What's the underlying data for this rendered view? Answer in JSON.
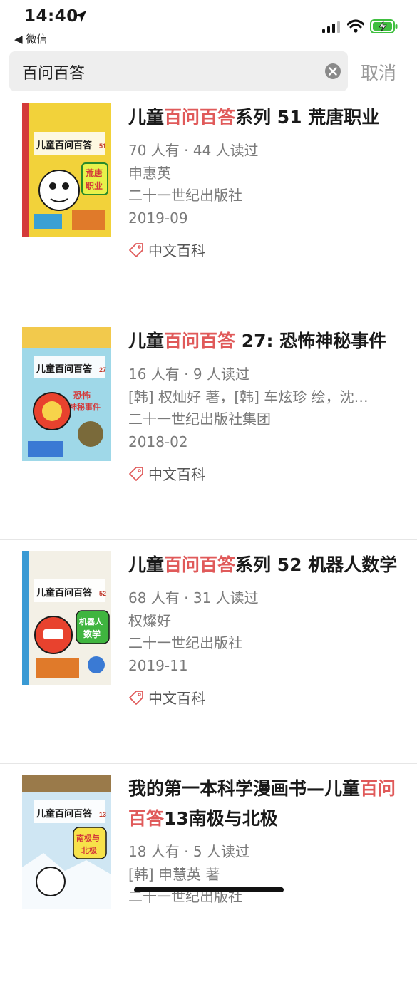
{
  "status_bar": {
    "time": "14:40",
    "back_label": "◀ 微信"
  },
  "search": {
    "query": "百问百答",
    "cancel_label": "取消"
  },
  "results": [
    {
      "title_parts": [
        "儿童",
        "百问百答",
        "系列 51 荒唐职业"
      ],
      "stats": "70 人有 · 44 人读过",
      "author": "申惠英",
      "publisher": "二十一世纪出版社",
      "date": "2019-09",
      "tag": "中文百科",
      "cover": {
        "series": "儿童百问百答",
        "number": "51",
        "topic_lines": [
          "荒唐",
          "职业"
        ],
        "bg": "#f2d23a"
      }
    },
    {
      "title_parts": [
        "儿童",
        "百问百答",
        " 27: 恐怖神秘事件"
      ],
      "stats": "16 人有 · 9 人读过",
      "author": "[韩] 权灿好 著，[韩] 车炫珍 绘，沈…",
      "publisher": "二十一世纪出版社集团",
      "date": "2018-02",
      "tag": "中文百科",
      "cover": {
        "series": "儿童百问百答",
        "number": "27",
        "topic_lines": [
          "恐怖",
          "神秘事件"
        ],
        "bg": "#9fd8e8"
      }
    },
    {
      "title_parts": [
        "儿童",
        "百问百答",
        "系列 52 机器人数学"
      ],
      "stats": "68 人有 · 31 人读过",
      "author": "权燦好",
      "publisher": "二十一世纪出版社",
      "date": "2019-11",
      "tag": "中文百科",
      "cover": {
        "series": "儿童百问百答",
        "number": "52",
        "topic_lines": [
          "机器人",
          "数学"
        ],
        "bg": "#f3f0e6"
      }
    },
    {
      "title_parts": [
        "我的第一本科学漫画书—儿童",
        "百问百答",
        "13南极与北极"
      ],
      "stats": "18 人有 · 5 人读过",
      "author": "[韩] 申慧英 著",
      "publisher": "二十一世纪出版社",
      "date": "",
      "tag": "",
      "cover": {
        "series": "儿童百问百答",
        "number": "13",
        "topic_lines": [
          "南极与",
          "北极"
        ],
        "bg": "#cfe6f3"
      }
    }
  ],
  "colors": {
    "highlight": "#e05a5a",
    "meta": "#7a7a7a",
    "cancel": "#9a9a9a",
    "search_bg": "#eeeeee"
  },
  "icons": [
    "location-arrow-icon",
    "signal-icon",
    "wifi-icon",
    "battery-charging-icon",
    "clear-icon",
    "tag-icon"
  ]
}
